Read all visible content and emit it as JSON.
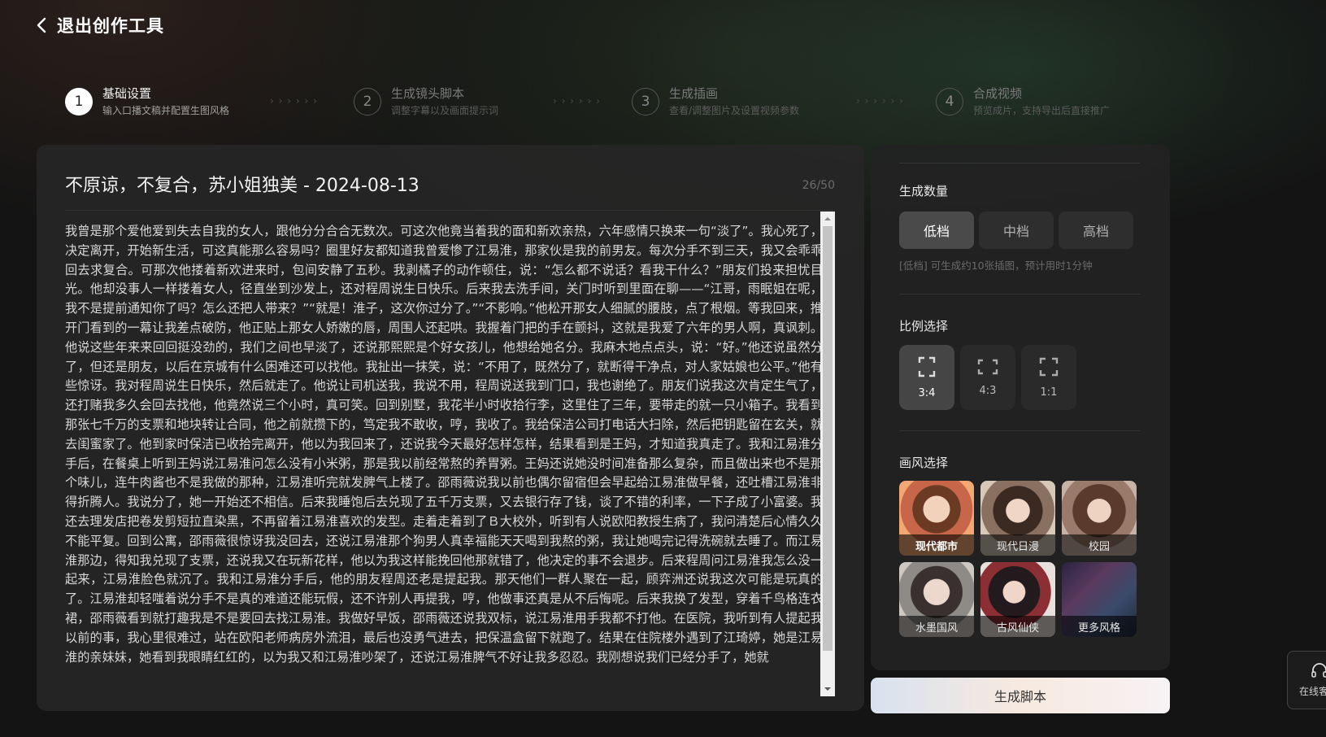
{
  "header": {
    "back_label": "退出创作工具"
  },
  "steps": [
    {
      "num": "1",
      "title": "基础设置",
      "subtitle": "输入口播文稿并配置生图风格"
    },
    {
      "num": "2",
      "title": "生成镜头脚本",
      "subtitle": "调整字幕以及画面提示词"
    },
    {
      "num": "3",
      "title": "生成插画",
      "subtitle": "查看/调整图片及设置视频参数"
    },
    {
      "num": "4",
      "title": "合成视频",
      "subtitle": "预览成片，支持导出后直接推广"
    }
  ],
  "steps_arrows": "› › › › › ›",
  "editor": {
    "title": "不原谅，不复合，苏小姐独美 - 2024-08-13",
    "counter": "26/50",
    "body": "我曾是那个爱他爱到失去自我的女人，跟他分分合合无数次。可这次他竟当着我的面和新欢亲热，六年感情只换来一句“淡了”。我心死了，决定离开，开始新生活，可这真能那么容易吗？圈里好友都知道我曾爱惨了江易淮，那家伙是我的前男友。每次分手不到三天，我又会乖乖回去求复合。可那次他搂着新欢进来时，包间安静了五秒。我剥橘子的动作顿住，说：“怎么都不说话？看我干什么？”朋友们投来担忧目光。他却没事人一样搂着女人，径直坐到沙发上，还对程周说生日快乐。后来我去洗手间，关门时听到里面在聊——“江哥，雨眠姐在呢，我不是提前通知你了吗？怎么还把人带来？”“就是！淮子，这次你过分了。”“不影响。”他松开那女人细腻的腰肢，点了根烟。等我回来，推开门看到的一幕让我差点破防，他正贴上那女人娇嫩的唇，周围人还起哄。我握着门把的手在颤抖，这就是我爱了六年的男人啊，真讽刺。他说这些年来来回回挺没劲的，我们之间也早淡了，还说那熙熙是个好女孩儿，他想给她名分。我麻木地点点头，说：“好。”他还说虽然分了，但还是朋友，以后在京城有什么困难还可以找他。我扯出一抹笑，说：“不用了，既然分了，就断得干净点，对人家姑娘也公平。”他有些惊讶。我对程周说生日快乐，然后就走了。他说让司机送我，我说不用，程周说送我到门口，我也谢绝了。朋友们说我这次肯定生气了，还打赌我多久会回去找他，他竟然说三个小时，真可笑。回到别墅，我花半小时收拾行李，这里住了三年，要带走的就一只小箱子。我看到那张七千万的支票和地块转让合同，他之前就攒下的，笃定我不敢收，哼，我收了。我给保洁公司打电话大扫除，然后把钥匙留在玄关，就去闺蜜家了。他到家时保洁已收拾完离开，他以为我回来了，还说我今天最好怎样怎样，结果看到是王妈，才知道我真走了。我和江易淮分手后，在餐桌上听到王妈说江易淮问怎么没有小米粥，那是我以前经常熬的养胃粥。王妈还说她没时间准备那么复杂，而且做出来也不是那个味儿，连牛肉酱也不是我做的那种，江易淮听完就发脾气上楼了。邵雨薇说我以前也偶尔留宿但会早起给江易淮做早餐，还吐槽江易淮非得折腾人。我说分了，她一开始还不相信。后来我睡饱后去兑现了五千万支票，又去银行存了钱，谈了不错的利率，一下子成了小富婆。我还去理发店把卷发剪短拉直染黑，不再留着江易淮喜欢的发型。走着走着到了Ｂ大校外，听到有人说欧阳教授生病了，我问清楚后心情久久不能平复。回到公寓，邵雨薇很惊讶我没回去，还说江易淮那个狗男人真幸福能天天喝到我熬的粥，我让她喝完记得洗碗就去睡了。而江易淮那边，得知我兑现了支票，还说我又在玩新花样，他以为我这样能挽回他那就错了，他决定的事不会退步。后来程周问江易淮我怎么没一起来，江易淮脸色就沉了。我和江易淮分手后，他的朋友程周还老是提起我。那天他们一群人聚在一起，顾弈洲还说我这次可能是玩真的了。江易淮却轻嗤着说分手不是真的难道还能玩假，还不许别人再提我，哼，他做事还真是从不后悔呢。后来我换了发型，穿着千鸟格连衣裙，邵雨薇看到就打趣我是不是要回去找江易淮。我做好早饭，邵雨薇还说我双标，说江易淮用手我都不打他。在医院，我听到有人提起我以前的事，我心里很难过，站在欧阳老师病房外流泪，最后也没勇气进去，把保温盒留下就跑了。结果在住院楼外遇到了江琦婷，她是江易淮的亲妹妹，她看到我眼睛红红的，以为我又和江易淮吵架了，还说江易淮脾气不好让我多忍忍。我刚想说我们已经分手了，她就"
  },
  "settings": {
    "quantity_label": "生成数量",
    "quantity_options": [
      "低档",
      "中档",
      "高档"
    ],
    "quantity_selected": "低档",
    "quantity_hint": "[低档] 可生成约10张插图，预计用时1分钟",
    "ratio_label": "比例选择",
    "ratio_options": [
      "3:4",
      "4:3",
      "1:1"
    ],
    "ratio_selected": "3:4",
    "style_label": "画风选择",
    "styles": [
      "现代都市",
      "现代日漫",
      "校园",
      "水墨国风",
      "古风仙侠",
      "更多风格"
    ],
    "style_selected": "现代都市"
  },
  "generate_button": "生成脚本",
  "service": {
    "label": "在线客服"
  },
  "colors": {
    "background": "#141414",
    "panel": "#262626",
    "accent_gradient_start": "#d8e2ef",
    "accent_gradient_end": "#f7f2f5"
  },
  "icons": {
    "back": "chevron-left-icon",
    "ratio": "crop-frame-icon",
    "service": "headset-icon"
  }
}
